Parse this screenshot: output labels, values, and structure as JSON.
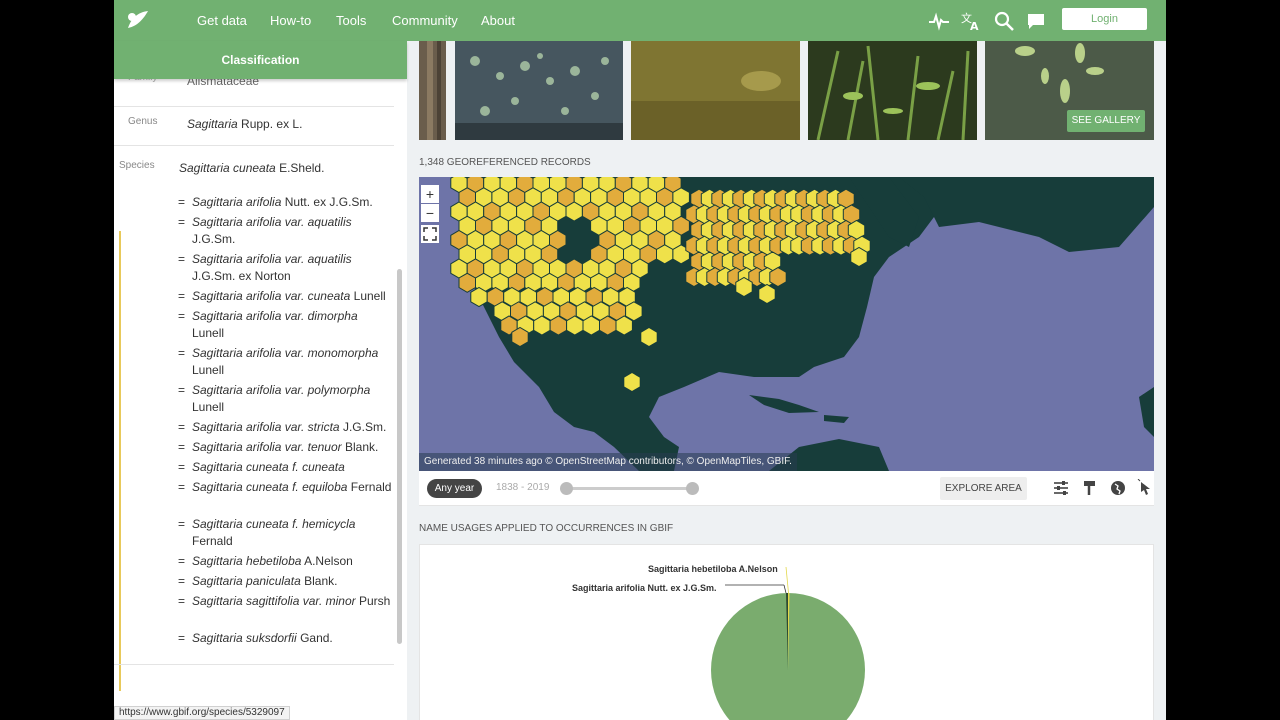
{
  "nav": {
    "links": [
      "Get data",
      "How-to",
      "Tools",
      "Community",
      "About"
    ],
    "login_label": "Login",
    "icons": [
      "activity-icon",
      "translate-icon",
      "search-icon",
      "chat-icon"
    ]
  },
  "classification": {
    "title": "Classification",
    "family": {
      "label": "Family",
      "value": "Alismataceae"
    },
    "genus": {
      "label": "Genus",
      "name": "Sagittaria",
      "author": "Rupp. ex L."
    },
    "species": {
      "label": "Species",
      "name": "Sagittaria cuneata",
      "author": "E.Sheld."
    },
    "synonyms": [
      {
        "name": "Sagittaria arifolia",
        "author": "Nutt. ex J.G.Sm."
      },
      {
        "name": "Sagittaria arifolia var. aquatilis",
        "author": "J.G.Sm."
      },
      {
        "name": "Sagittaria arifolia var. aquatilis",
        "author": "J.G.Sm. ex Norton"
      },
      {
        "name": "Sagittaria arifolia var. cuneata",
        "author": "Lunell"
      },
      {
        "name": "Sagittaria arifolia var. dimorpha",
        "author": "Lunell"
      },
      {
        "name": "Sagittaria arifolia var. monomorpha",
        "author": "Lunell"
      },
      {
        "name": "Sagittaria arifolia var. polymorpha",
        "author": "Lunell"
      },
      {
        "name": "Sagittaria arifolia var. stricta",
        "author": "J.G.Sm."
      },
      {
        "name": "Sagittaria arifolia var. tenuor",
        "author": "Blank."
      },
      {
        "name": "Sagittaria cuneata f. cuneata",
        "author": ""
      },
      {
        "name": "Sagittaria cuneata f. equiloba",
        "author": "Fernald"
      },
      {
        "name": "Sagittaria cuneata f. hemicycla",
        "author": "Fernald"
      },
      {
        "name": "Sagittaria hebetiloba",
        "author": "A.Nelson"
      },
      {
        "name": "Sagittaria paniculata",
        "author": "Blank."
      },
      {
        "name": "Sagittaria sagittifolia var. minor",
        "author": "Pursh"
      },
      {
        "name": "Sagittaria suksdorfii",
        "author": "Gand."
      }
    ]
  },
  "status_url": "https://www.gbif.org/species/5329097",
  "gallery": {
    "button_label": "SEE GALLERY"
  },
  "map": {
    "records_label": "1,348 GEOREFERENCED RECORDS",
    "attribution": "Generated 38 minutes ago © OpenStreetMap contributors, © OpenMapTiles, GBIF.",
    "zoom_in": "+",
    "zoom_out": "−",
    "year_chip": "Any year",
    "year_range": "1838 - 2019",
    "explore_label": "EXPLORE AREA",
    "colors": {
      "ocean": "#6e74a8",
      "land": "#173d3a",
      "hex_light": "#efe14a",
      "hex_dark": "#e2ac3c"
    }
  },
  "name_usages": {
    "title": "NAME USAGES APPLIED TO OCCURRENCES IN GBIF",
    "labels": [
      "Sagittaria hebetiloba A.Nelson",
      "Sagittaria arifolia Nutt. ex J.G.Sm."
    ]
  }
}
